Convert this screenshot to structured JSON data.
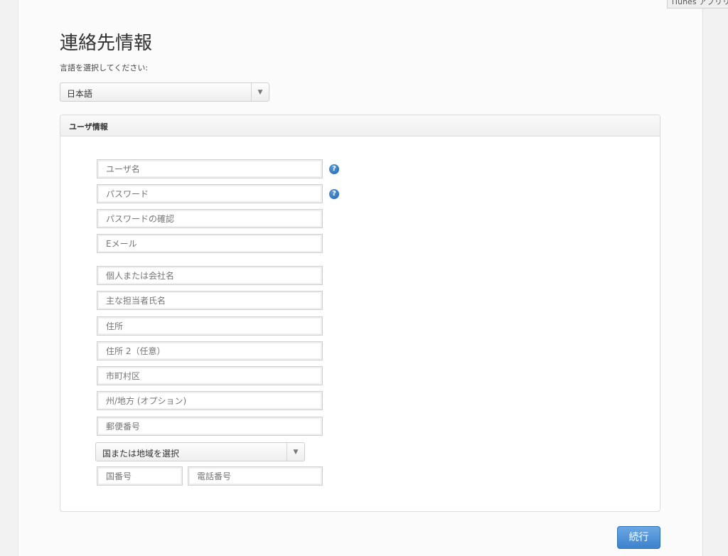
{
  "corner_tab": {
    "label": "iTunes アプリリ"
  },
  "page": {
    "title": "連絡先情報"
  },
  "language": {
    "label": "言語を選択してください:",
    "selected": "日本語"
  },
  "user_info": {
    "header": "ユーザ情報",
    "fields": {
      "username": "ユーザ名",
      "password": "パスワード",
      "password_confirm": "パスワードの確認",
      "email": "Eメール",
      "name_or_company": "個人または会社名",
      "primary_contact": "主な担当者氏名",
      "address": "住所",
      "address2": "住所 2（任意）",
      "city": "市町村区",
      "state": "州/地方 (オプション)",
      "postal_code": "郵便番号",
      "country_code": "国番号",
      "phone": "電話番号"
    },
    "country_select": {
      "selected": "国または地域を選択"
    },
    "help_icon_glyph": "?"
  },
  "actions": {
    "continue_label": "続行"
  },
  "icons": {
    "dropdown_arrow": "▼"
  },
  "colors": {
    "accent": "#3d82cc",
    "help_icon": "#1e63b0"
  }
}
